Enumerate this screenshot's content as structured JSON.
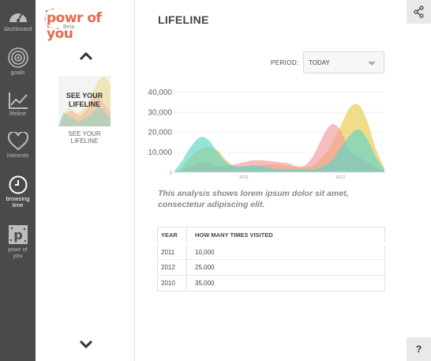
{
  "nav": {
    "items": [
      {
        "label": "dashboard",
        "icon": "gauge-icon"
      },
      {
        "label": "goals",
        "icon": "target-icon"
      },
      {
        "label": "lifeline",
        "icon": "line-chart-icon"
      },
      {
        "label": "interests",
        "icon": "heart-icon"
      },
      {
        "label": "browsing time",
        "icon": "clock-icon",
        "active": true
      },
      {
        "label": "powr of you",
        "icon": "powr-logo-icon"
      }
    ]
  },
  "brand": {
    "name": "powr of you",
    "beta": "Beta",
    "color": "#e8694a"
  },
  "card": {
    "thumb_title": "SEE YOUR LIFELINE",
    "label": "SEE YOUR LIFELINE"
  },
  "page": {
    "title": "LIFELINE"
  },
  "period": {
    "label": "PERIOD:",
    "value": "TODAY"
  },
  "analysis": "This analysis shows lorem ipsum dolor sit amet, consectetur adipiscing elit.",
  "table": {
    "headers": [
      "YEAR",
      "HOW MANY TIMES VISITED"
    ],
    "rows": [
      [
        "2011",
        "10,000"
      ],
      [
        "2012",
        "25,000"
      ],
      [
        "2010",
        "35,000"
      ]
    ]
  },
  "help": "?",
  "chart_data": {
    "type": "area",
    "x": [
      0,
      1,
      2,
      3,
      4,
      5,
      6,
      7,
      8,
      9,
      10,
      11,
      12,
      13,
      14,
      15,
      16,
      17,
      18,
      19,
      20,
      21,
      22,
      23,
      24
    ],
    "x_ticks": [
      {
        "at": 8,
        "label": "2011"
      },
      {
        "at": 19,
        "label": "2012"
      }
    ],
    "y_ticks": [
      "0",
      "10,000",
      "20,000",
      "30,000",
      "40,000"
    ],
    "ylim": [
      0,
      40000
    ],
    "series": [
      {
        "color": "#e8c94a",
        "values": [
          0,
          2500,
          8000,
          11500,
          12500,
          11000,
          6000,
          2500,
          2500,
          3000,
          3500,
          4000,
          3800,
          3000,
          2500,
          2500,
          3500,
          8000,
          14000,
          23000,
          32000,
          34000,
          26000,
          12000,
          2000
        ]
      },
      {
        "color": "#f09a9a",
        "values": [
          0,
          1000,
          3000,
          5000,
          4500,
          3000,
          3000,
          4000,
          5000,
          6000,
          6000,
          5500,
          5000,
          4500,
          3000,
          3500,
          9000,
          18000,
          24000,
          21000,
          11000,
          8000,
          5000,
          2500,
          1000
        ]
      },
      {
        "color": "#5cd4c8",
        "values": [
          0,
          6000,
          13000,
          17500,
          16000,
          10000,
          5000,
          3000,
          3000,
          3500,
          3000,
          2000,
          1500,
          1500,
          1500,
          1500,
          1500,
          3000,
          6000,
          12000,
          18000,
          21500,
          17000,
          8000,
          1000
        ]
      }
    ]
  }
}
